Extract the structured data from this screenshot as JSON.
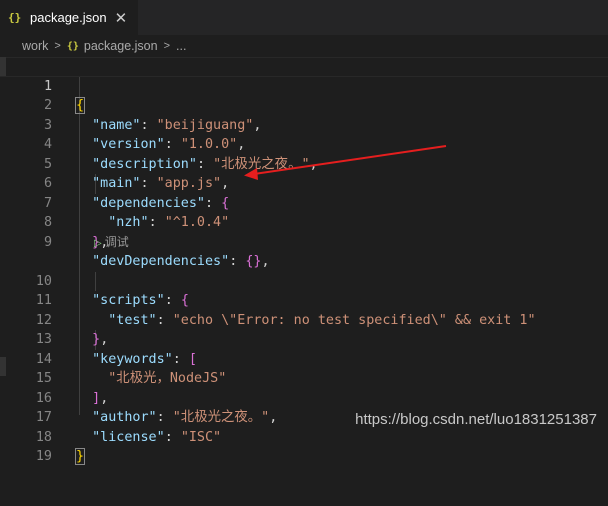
{
  "tab": {
    "icon": "{}",
    "title": "package.json",
    "close": "✕"
  },
  "breadcrumb": {
    "folder": "work",
    "sep1": ">",
    "icon": "{}",
    "file": "package.json",
    "sep2": ">",
    "more": "..."
  },
  "editor": {
    "code_lens": "调试",
    "line_numbers": [
      "1",
      "2",
      "3",
      "4",
      "5",
      "6",
      "7",
      "8",
      "9",
      "10",
      "11",
      "12",
      "13",
      "14",
      "15",
      "16",
      "17",
      "18",
      "19"
    ]
  },
  "watermark": "https://blog.csdn.net/luo1831251387",
  "colors": {
    "arrow": "#e51e1e",
    "key": "#9cdcfe",
    "string": "#ce9178"
  }
}
